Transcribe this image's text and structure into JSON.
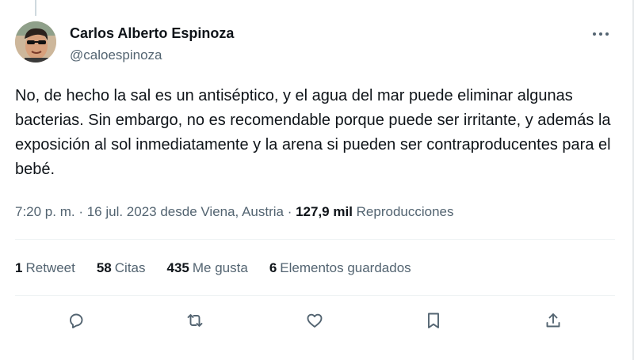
{
  "author": {
    "display_name": "Carlos Alberto Espinoza",
    "handle": "@caloespinoza"
  },
  "tweet": {
    "text": "No, de hecho la sal es un antiséptico, y el agua del mar puede eliminar algunas bacterias. Sin embargo, no es recomendable porque puede ser irritante, y además la exposición al sol inmediatamente y la arena si pueden ser contraproducentes para el bebé.",
    "time": "7:20 p. m.",
    "date_location": "16 jul. 2023 desde Viena, Austria",
    "separator": "·",
    "views_count": "127,9 mil",
    "views_label": "Reproducciones"
  },
  "stats": {
    "retweets_count": "1",
    "retweets_label": "Retweet",
    "quotes_count": "58",
    "quotes_label": "Citas",
    "likes_count": "435",
    "likes_label": "Me gusta",
    "bookmarks_count": "6",
    "bookmarks_label": "Elementos guardados"
  },
  "icons": {
    "more": "more-horizontal-icon",
    "reply": "reply-icon",
    "retweet": "retweet-icon",
    "like": "heart-icon",
    "bookmark": "bookmark-icon",
    "share": "share-icon"
  },
  "colors": {
    "text_primary": "#0f1419",
    "text_secondary": "#536471",
    "divider": "#eff3f4"
  }
}
